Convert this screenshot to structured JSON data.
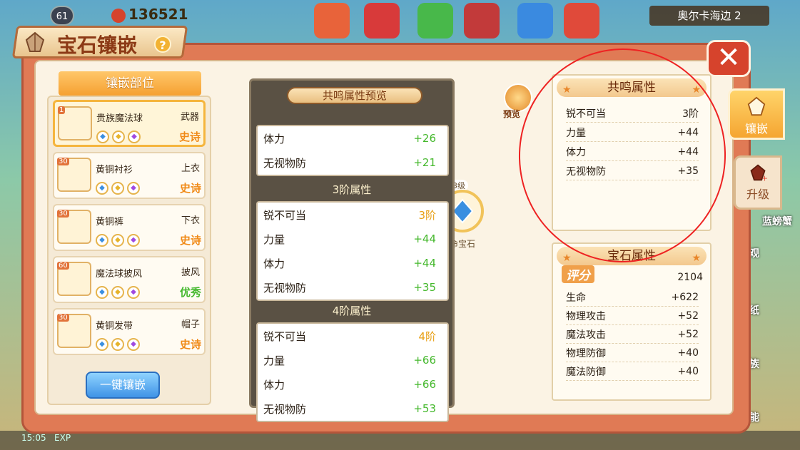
{
  "hud": {
    "level": "61",
    "currency": "136521",
    "map_name": "奥尔卡海边 2",
    "time": "15:05",
    "exp_label": "EXP",
    "right_labels": [
      "蓝螃蟹",
      "观",
      "纸",
      "族",
      "能"
    ]
  },
  "panel": {
    "title": "宝石镶嵌",
    "help": "?",
    "close": "✕"
  },
  "left": {
    "header": "镶嵌部位",
    "slots": [
      {
        "level": "1",
        "name": "贵族魔法球",
        "type": "武器",
        "quality": "史诗",
        "quality_color": "#f08a16",
        "selected": true
      },
      {
        "level": "30",
        "name": "黄铜衬衫",
        "type": "上衣",
        "quality": "史诗",
        "quality_color": "#f08a16",
        "selected": false
      },
      {
        "level": "30",
        "name": "黄铜裤",
        "type": "下衣",
        "quality": "史诗",
        "quality_color": "#f08a16",
        "selected": false
      },
      {
        "level": "60",
        "name": "魔法球披风",
        "type": "披风",
        "quality": "优秀",
        "quality_color": "#44b82c",
        "selected": false
      },
      {
        "level": "30",
        "name": "黄铜发带",
        "type": "帽子",
        "quality": "史诗",
        "quality_color": "#f08a16",
        "selected": false
      }
    ],
    "onekey_button": "一键镶嵌"
  },
  "middle": {
    "level_3": "3级",
    "ring_level": "3级",
    "ring_label": "生命宝石",
    "preview_button": "预览"
  },
  "preview": {
    "title": "共鸣属性预览",
    "group1": [
      {
        "name": "体力",
        "value": "+26"
      },
      {
        "name": "无视物防",
        "value": "+21"
      }
    ],
    "section3": "3阶属性",
    "group3": [
      {
        "name": "锐不可当",
        "value": "3阶"
      },
      {
        "name": "力量",
        "value": "+44"
      },
      {
        "name": "体力",
        "value": "+44"
      },
      {
        "name": "无视物防",
        "value": "+35"
      }
    ],
    "section4": "4阶属性",
    "group4": [
      {
        "name": "锐不可当",
        "value": "4阶"
      },
      {
        "name": "力量",
        "value": "+66"
      },
      {
        "name": "体力",
        "value": "+66"
      },
      {
        "name": "无视物防",
        "value": "+53"
      }
    ]
  },
  "resonance": {
    "title": "共鸣属性",
    "rows": [
      {
        "name": "锐不可当",
        "value": "3阶"
      },
      {
        "name": "力量",
        "value": "+44"
      },
      {
        "name": "体力",
        "value": "+44"
      },
      {
        "name": "无视物防",
        "value": "+35"
      }
    ]
  },
  "gem_attrs": {
    "title": "宝石属性",
    "score_label": "评分",
    "score": "2104",
    "rows": [
      {
        "name": "生命",
        "value": "+622"
      },
      {
        "name": "物理攻击",
        "value": "+52"
      },
      {
        "name": "魔法攻击",
        "value": "+52"
      },
      {
        "name": "物理防御",
        "value": "+40"
      },
      {
        "name": "魔法防御",
        "value": "+40"
      }
    ]
  },
  "tabs": {
    "inlay": "镶嵌",
    "upgrade": "升级"
  }
}
